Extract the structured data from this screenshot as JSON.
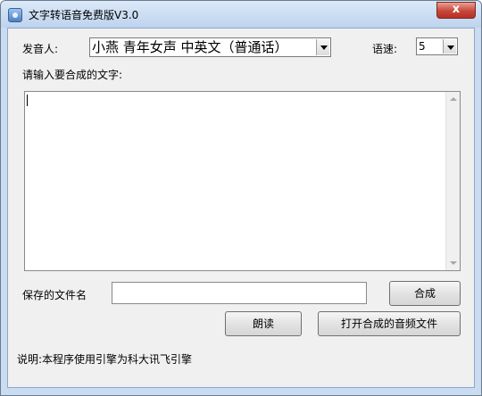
{
  "window": {
    "title": "文字转语音免费版V3.0",
    "close_glyph": "x"
  },
  "form": {
    "speaker_label": "发音人:",
    "speaker_value": "小燕 青年女声 中英文（普通话）",
    "speed_label": "语速:",
    "speed_value": "5",
    "text_prompt": "请输入要合成的文字:",
    "text_value": "",
    "filename_label": "保存的文件名",
    "filename_value": ""
  },
  "buttons": {
    "synthesize": "合成",
    "read": "朗读",
    "open_file": "打开合成的音频文件"
  },
  "footer": {
    "note": "说明:本程序使用引擎为科大讯飞引擎"
  }
}
